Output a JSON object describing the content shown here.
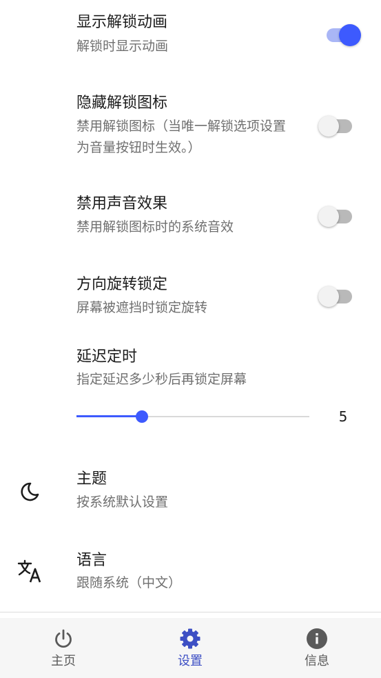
{
  "settings": {
    "unlock_animation": {
      "title": "显示解锁动画",
      "summary": "解锁时显示动画",
      "enabled": true
    },
    "hide_unlock_icon": {
      "title": "隐藏解锁图标",
      "summary": "禁用解锁图标（当唯一解锁选项设置为音量按钮时生效。）",
      "enabled": false
    },
    "disable_sound": {
      "title": "禁用声音效果",
      "summary": "禁用解锁图标时的系统音效",
      "enabled": false
    },
    "orientation_lock": {
      "title": "方向旋转锁定",
      "summary": "屏幕被遮挡时锁定旋转",
      "enabled": false
    },
    "delay_timer": {
      "title": "延迟定时",
      "summary": "指定延迟多少秒后再锁定屏幕",
      "value": "5",
      "fraction": 0.28
    },
    "theme": {
      "icon": "moon-icon",
      "title": "主题",
      "summary": "按系统默认设置"
    },
    "language": {
      "icon": "translate-icon",
      "title": "语言",
      "summary": "跟随系统（中文）"
    }
  },
  "bottom_nav": {
    "items": [
      {
        "icon": "power-icon",
        "label": "主页",
        "active": false
      },
      {
        "icon": "gear-icon",
        "label": "设置",
        "active": true
      },
      {
        "icon": "info-icon",
        "label": "信息",
        "active": false
      }
    ]
  },
  "colors": {
    "accent": "#3d5afe",
    "accent_track": "#a9b6f6",
    "switch_off_track": "#b9b9b9",
    "switch_off_thumb": "#f2f2f2",
    "active_nav_label": "#3d4fc4",
    "title_text": "#1c1c1c",
    "summary_text": "#6f6f6f"
  }
}
